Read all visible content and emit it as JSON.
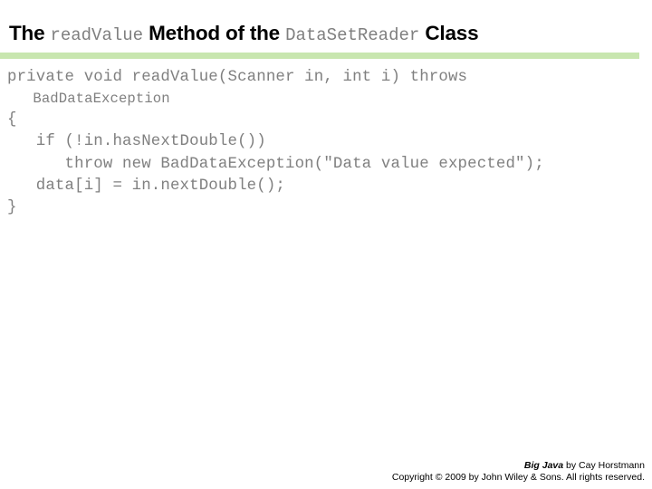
{
  "slide": {
    "title_parts": [
      {
        "text": "The ",
        "style": "text"
      },
      {
        "text": "readValue",
        "style": "code"
      },
      {
        "text": " Method of the ",
        "style": "text"
      },
      {
        "text": "DataSetReader",
        "style": "code"
      },
      {
        "text": " Class",
        "style": "text"
      }
    ],
    "title_plain": "The readValue Method of the DataSetReader Class",
    "divider_color": "#c8e6af",
    "code_color": "#808080",
    "code_lines": [
      {
        "text": "private void readValue(Scanner in, int i) throws",
        "wrapped": false
      },
      {
        "text": "   BadDataException",
        "wrapped": true
      },
      {
        "text": "{",
        "wrapped": false
      },
      {
        "text": "   if (!in.hasNextDouble())",
        "wrapped": false
      },
      {
        "text": "      throw new BadDataException(\"Data value expected\");",
        "wrapped": false
      },
      {
        "text": "   data[i] = in.nextDouble();",
        "wrapped": false
      },
      {
        "text": "}",
        "wrapped": false
      }
    ],
    "footer": {
      "line1_title": "Big Java",
      "line1_rest": " by Cay Horstmann",
      "line2": "Copyright © 2009 by John Wiley & Sons.  All rights reserved."
    }
  }
}
